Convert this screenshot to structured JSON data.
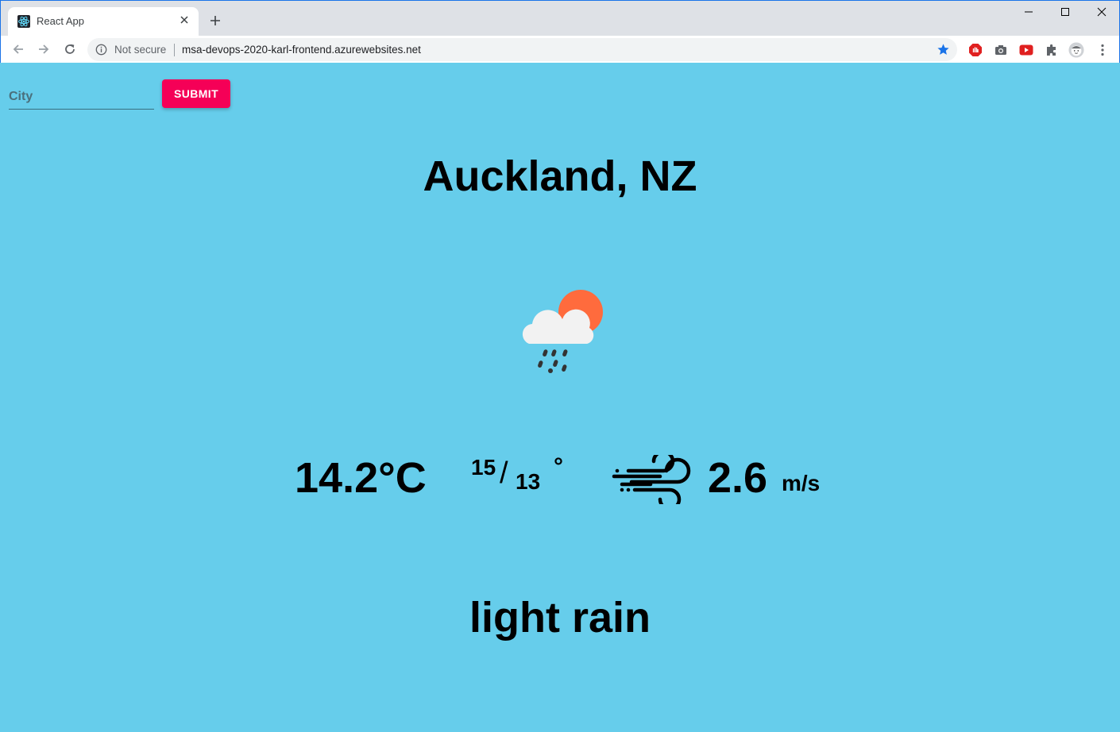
{
  "browser": {
    "tab_title": "React App",
    "security_label": "Not secure",
    "url": "msa-devops-2020-karl-frontend.azurewebsites.net",
    "accent": "#1a73e8"
  },
  "form": {
    "city_placeholder": "City",
    "city_value": "",
    "submit_label": "SUBMIT",
    "submit_color": "#f50057"
  },
  "weather": {
    "location": "Auckland, NZ",
    "icon": "cloud-sun-rain-icon",
    "temperature": "14.2°C",
    "temp_max": "15",
    "temp_min": "13",
    "temp_slash": "/",
    "degree_symbol": "°",
    "wind_icon": "wind-icon",
    "wind_speed": "2.6",
    "wind_unit": "m/s",
    "description": "light rain",
    "background": "#66cdeb"
  }
}
